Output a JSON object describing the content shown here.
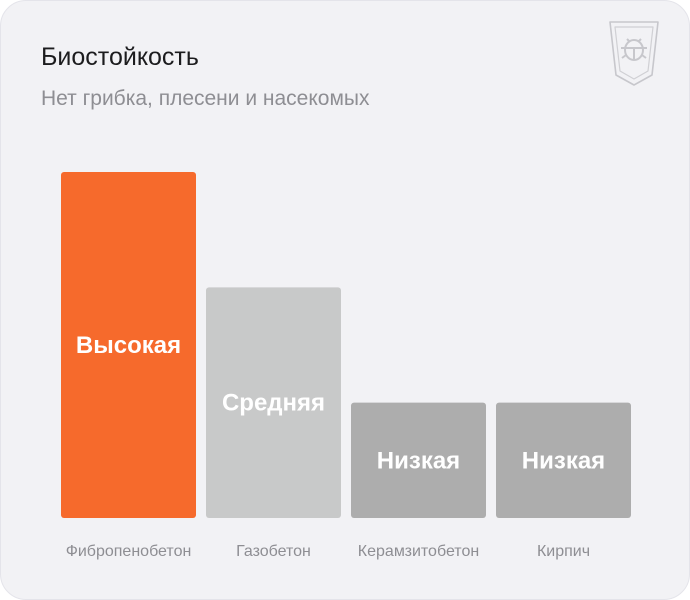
{
  "card": {
    "title": "Биостойкость",
    "subtitle": "Нет грибка, плесени и насекомых",
    "icon": "shield-bug-icon"
  },
  "colors": {
    "background": "#f2f2f5",
    "highlight": "#f66a2c",
    "medium": "#c8c9c9",
    "low": "#adadad"
  },
  "chart_data": {
    "type": "bar",
    "title": "Биостойкость",
    "subtitle": "Нет грибка, плесени и насекомых",
    "categories": [
      "Фибропенобетон",
      "Газобетон",
      "Керамзитобетон",
      "Кирпич"
    ],
    "values": [
      3,
      2,
      1,
      1
    ],
    "labels": [
      "Высокая",
      "Средняя",
      "Низкая",
      "Низкая"
    ],
    "bar_colors": [
      "#f66a2c",
      "#c8c9c9",
      "#adadad",
      "#adadad"
    ],
    "xlabel": "",
    "ylabel": "",
    "grid": false,
    "legend": "none",
    "axes_visible": false
  }
}
